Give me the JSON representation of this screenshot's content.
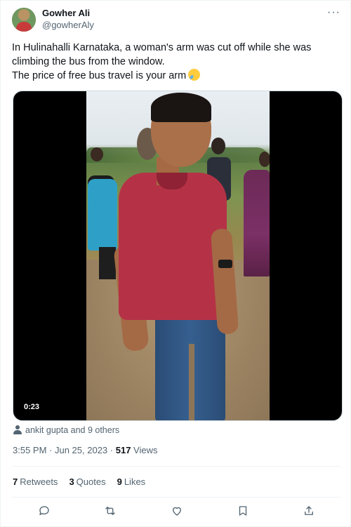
{
  "author": {
    "name": "Gowher Ali",
    "handle": "@gowherAly"
  },
  "more_icon": "more-horizontal-icon",
  "tweet": {
    "text": "In Hulinahalli Karnataka, a woman's arm was cut off while she was climbing the bus from the window.\n The price of free bus travel is your arm",
    "emoji": "crying-face-emoji"
  },
  "media": {
    "duration": "0:23"
  },
  "tagged": {
    "icon": "person-icon",
    "text": "ankit gupta and 9 others"
  },
  "meta": {
    "time": "3:55 PM",
    "separator": " · ",
    "date": "Jun 25, 2023",
    "views_count": "517",
    "views_label": " Views"
  },
  "stats": {
    "retweets_count": "7",
    "retweets_label": "Retweets",
    "quotes_count": "3",
    "quotes_label": "Quotes",
    "likes_count": "9",
    "likes_label": "Likes"
  },
  "actions": [
    "reply-icon",
    "retweet-icon",
    "like-icon",
    "bookmark-icon",
    "share-icon"
  ],
  "colors": {
    "text_primary": "#0f1419",
    "text_secondary": "#536471",
    "divider": "#eff3f4"
  }
}
